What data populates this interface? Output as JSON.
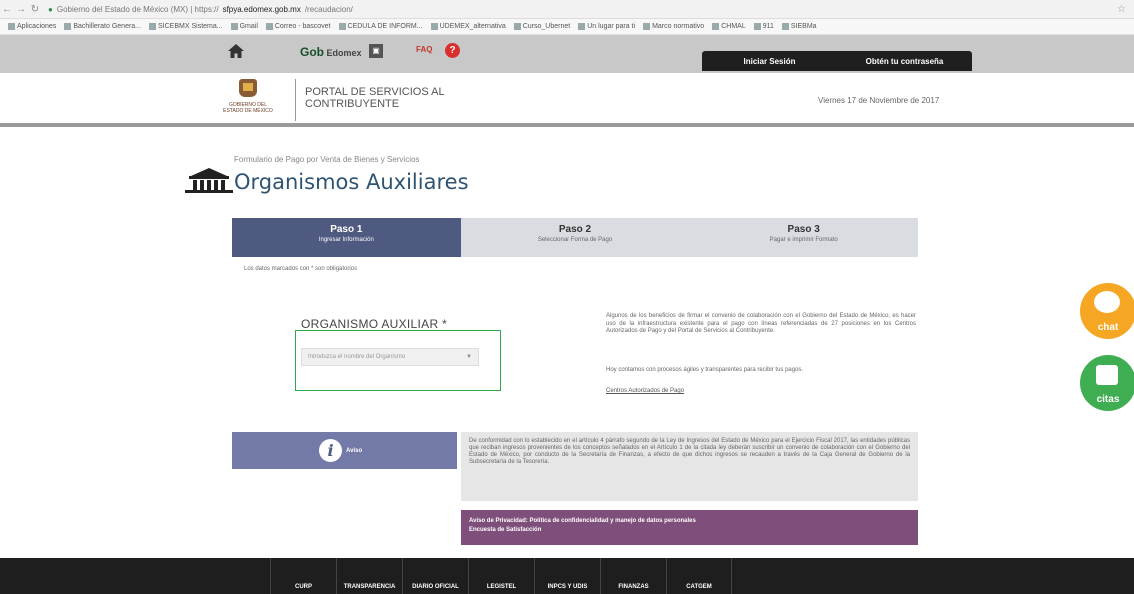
{
  "browser": {
    "url_prefix": "Gobierno del Estado de México (MX) | https://",
    "url_host": "sfpya.edomex.gob.mx",
    "url_path": "/recaudacion/",
    "bookmarks": [
      "Aplicaciones",
      "Bachillerato Genera...",
      "SICEBMX Sistema...",
      "Gmail",
      "Correo - bascovet",
      "CEDULA DE INFORM...",
      "UDEMEX_alternativa",
      "Curso_Ubernet",
      "Un lugar para ti",
      "Marco normativo",
      "CHMAL",
      "911",
      "SIEBMa"
    ]
  },
  "topbar": {
    "brand": "Gob",
    "brand_suffix": "Edomex",
    "faq": "FAQ",
    "login": "Iniciar Sesión",
    "password": "Obtén tu contraseña"
  },
  "header": {
    "logo_text": "GOBIERNO DEL ESTADO DE MÉXICO",
    "portal_title": "PORTAL DE SERVICIOS AL\nCONTRIBUYENTE",
    "date": "Viernes 17 de Noviembre de 2017"
  },
  "main": {
    "subtitle": "Formulario de Pago por Venta de Bienes y Servicios",
    "title": "Organismos Auxiliares",
    "steps": [
      {
        "title": "Paso 1",
        "subtitle": "Ingresar Información"
      },
      {
        "title": "Paso 2",
        "subtitle": "Seleccionar Forma de Pago"
      },
      {
        "title": "Paso 3",
        "subtitle": "Pagar e imprimir Formato"
      }
    ],
    "required_note": "Los datos marcados con * son obligatorios",
    "org_label": "ORGANISMO AUXILIAR *",
    "org_placeholder": "Introduzca el nombre del Organismo",
    "info_text": "Algunos de los beneficios de firmar el convenio de colaboración con el Gobierno del Estado de México, es hacer uso de la infraestructura existente para el pago con líneas referenciadas de 27 posiciones en los Centros Autorizados de Pago y del Portal de Servicios al Contribuyente.",
    "info_text2": "Hoy contamos con procesos ágiles y transparentes para recibir tus pagos.",
    "centros_link": "Centros Autorizados de Pago",
    "aviso_label": "Aviso",
    "aviso_text": "De conformidad con lo establecido en el artículo 4 párrafo segundo de la Ley de Ingresos del Estado de México para el Ejercicio Fiscal 2017, las entidades públicas que reciban ingresos provenientes de los conceptos señalados en el Artículo 1 de la citada ley deberán suscribir un convenio de colaboración con el Gobierno del Estado de México, por conducto de la Secretaría de Finanzas, a efecto de que dichos ingresos se recauden a través de la Caja General de Gobierno de la Subsecretaría de la Tesorería.",
    "privacy_line1": "Aviso de Privacidad: Política de confidencialidad y manejo de datos personales",
    "privacy_line2": "Encuesta de Satisfacción"
  },
  "footer": {
    "links": [
      "CURP",
      "TRANSPARENCIA",
      "DIARIO OFICIAL",
      "LEGISTEL",
      "INPCS Y UDIS",
      "FINANZAS",
      "CATGEM"
    ]
  },
  "floating": {
    "chat": "chat",
    "citas": "citas"
  },
  "colors": {
    "step_active": "#4f5a80",
    "highlight_box": "#2ba84a",
    "privacy_bar": "#7d4f7a",
    "chat": "#f5a623",
    "citas": "#3fae52"
  }
}
